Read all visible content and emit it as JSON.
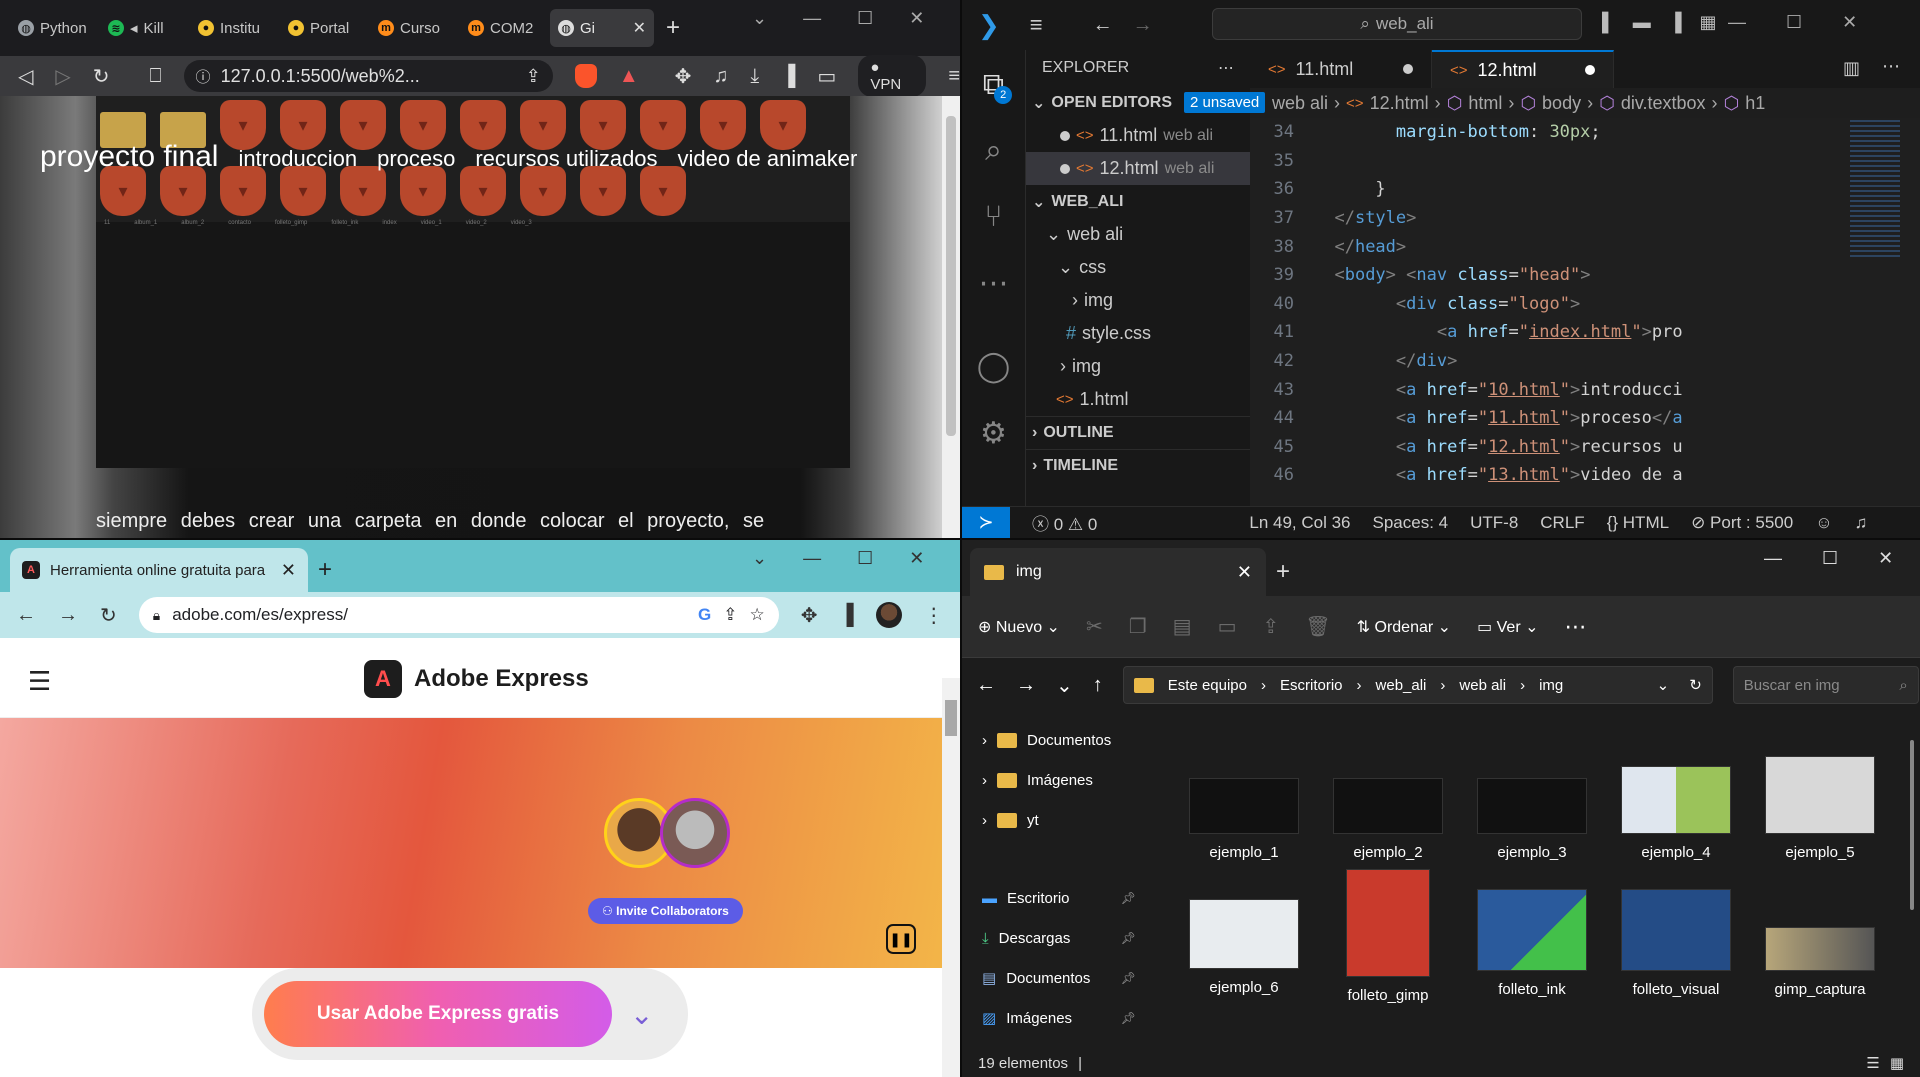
{
  "brave": {
    "tabs": [
      {
        "label": "Python",
        "color": "#9aa0a6"
      },
      {
        "label": "Kill",
        "color": "#1db954"
      },
      {
        "label": "Institu",
        "color": "#f1c232"
      },
      {
        "label": "Portal",
        "color": "#f1c232"
      },
      {
        "label": "Curso",
        "color": "#ff8c1a"
      },
      {
        "label": "COM2",
        "color": "#ff8c1a"
      },
      {
        "label": "Gi",
        "color": "#dddddd"
      }
    ],
    "url": "127.0.0.1:5500/web%2...",
    "vpn_label": "VPN",
    "page": {
      "logo": "proyecto final",
      "nav": [
        "introduccion",
        "proceso",
        "recursos utilizados",
        "video de animaker"
      ],
      "file_labels": [
        "11",
        "album_1",
        "album_2",
        "contacto",
        "folleto_gimp",
        "folleto_ink",
        "index",
        "video_1",
        "video_2",
        "video_3"
      ],
      "paragraph": "siempre debes crear una carpeta en donde colocar el proyecto, se"
    }
  },
  "vscode": {
    "search": "web_ali",
    "explorer_title": "EXPLORER",
    "open_editors": "OPEN EDITORS",
    "unsaved_badge": "2 unsaved",
    "open_files": [
      {
        "name": "11.html",
        "path": "web ali"
      },
      {
        "name": "12.html",
        "path": "web ali"
      }
    ],
    "workspace": "WEB_ALI",
    "tree": {
      "root": "web ali",
      "css": "css",
      "css_img": "img",
      "style": "style.css",
      "img": "img",
      "file1": "1.html"
    },
    "outline": "OUTLINE",
    "timeline": "TIMELINE",
    "tabs": [
      "11.html",
      "12.html"
    ],
    "breadcrumb": [
      "web ali",
      "12.html",
      "html",
      "body",
      "div.textbox",
      "h1"
    ],
    "accounts_badge": "2",
    "lines": {
      "n34": "34",
      "n35": "35",
      "n36": "36",
      "n37": "37",
      "n38": "38",
      "n39": "39",
      "n40": "40",
      "n41": "41",
      "n42": "42",
      "n43": "43",
      "n44": "44",
      "n45": "45",
      "n46": "46",
      "l34_prop": "margin-bottom",
      "l34_val": "30px",
      "nav_class": "head",
      "logo_class": "logo",
      "href_index": "index.html",
      "href_10": "10.html",
      "href_11": "11.html",
      "href_12": "12.html",
      "href_13": "13.html",
      "t41": "pro",
      "t43": "introducci",
      "t44": "proceso",
      "t45": "recursos u",
      "t46": "video de a"
    },
    "status": {
      "errors": "0",
      "warnings": "0",
      "position": "Ln 49, Col 36",
      "spaces": "Spaces: 4",
      "encoding": "UTF-8",
      "eol": "CRLF",
      "language": "HTML",
      "port": "Port : 5500"
    }
  },
  "chrome": {
    "tab_title": "Herramienta online gratuita para",
    "url": "adobe.com/es/express/",
    "brand": "Adobe Express",
    "invite": "Invite Collaborators",
    "cta": "Usar Adobe Express gratis"
  },
  "explorer": {
    "tab": "img",
    "new_label": "Nuevo",
    "sort_label": "Ordenar",
    "view_label": "Ver",
    "breadcrumb": [
      "Este equipo",
      "Escritorio",
      "web_ali",
      "web ali",
      "img"
    ],
    "search_placeholder": "Buscar en img",
    "nav_tree": [
      "Documentos",
      "Imágenes",
      "yt"
    ],
    "quick_access": [
      "Escritorio",
      "Descargas",
      "Documentos",
      "Imágenes"
    ],
    "files": [
      "ejemplo_1",
      "ejemplo_2",
      "ejemplo_3",
      "ejemplo_4",
      "ejemplo_5",
      "ejemplo_6",
      "folleto_gimp",
      "folleto_ink",
      "folleto_visual",
      "gimp_captura"
    ],
    "status": "19 elementos"
  }
}
